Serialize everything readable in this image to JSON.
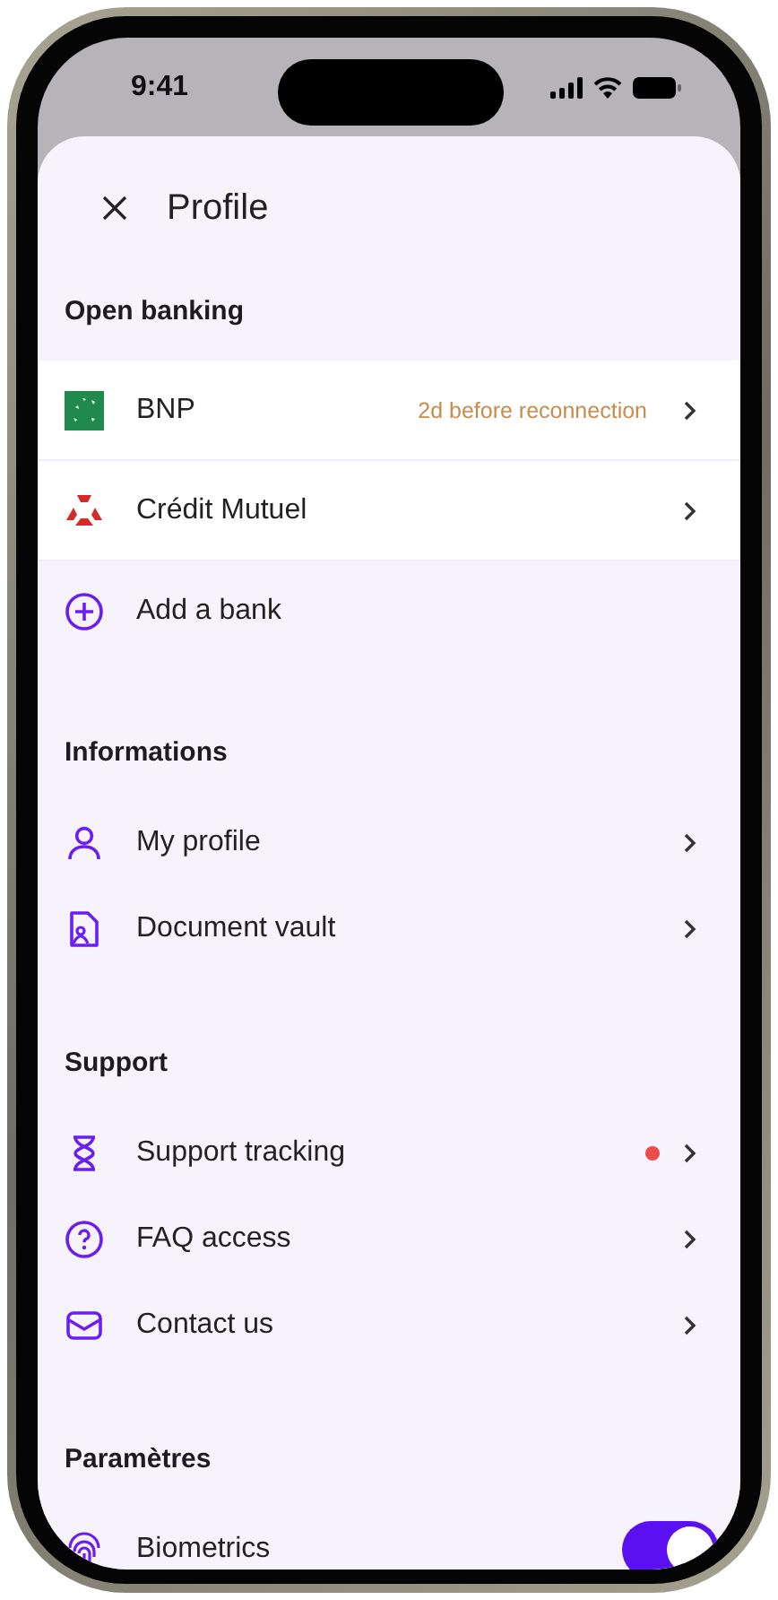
{
  "status_bar": {
    "time": "9:41"
  },
  "header": {
    "title": "Profile"
  },
  "sections": [
    {
      "title": "Open banking",
      "items": [
        {
          "kind": "bank",
          "label": "BNP",
          "status": "2d before reconnection"
        },
        {
          "kind": "bank",
          "label": "Crédit Mutuel"
        },
        {
          "kind": "action",
          "label": "Add a bank"
        }
      ]
    },
    {
      "title": "Informations",
      "items": [
        {
          "kind": "link",
          "label": "My profile",
          "notification": false
        },
        {
          "kind": "link",
          "label": "Document vault",
          "notification": false
        }
      ]
    },
    {
      "title": "Support",
      "items": [
        {
          "kind": "link",
          "label": "Support tracking",
          "notification": true
        },
        {
          "kind": "link",
          "label": "FAQ access",
          "notification": false
        },
        {
          "kind": "link",
          "label": "Contact us",
          "notification": false
        }
      ]
    },
    {
      "title": "Paramètres",
      "items": [
        {
          "kind": "toggle",
          "label": "Biometrics",
          "on": true
        }
      ]
    }
  ]
}
